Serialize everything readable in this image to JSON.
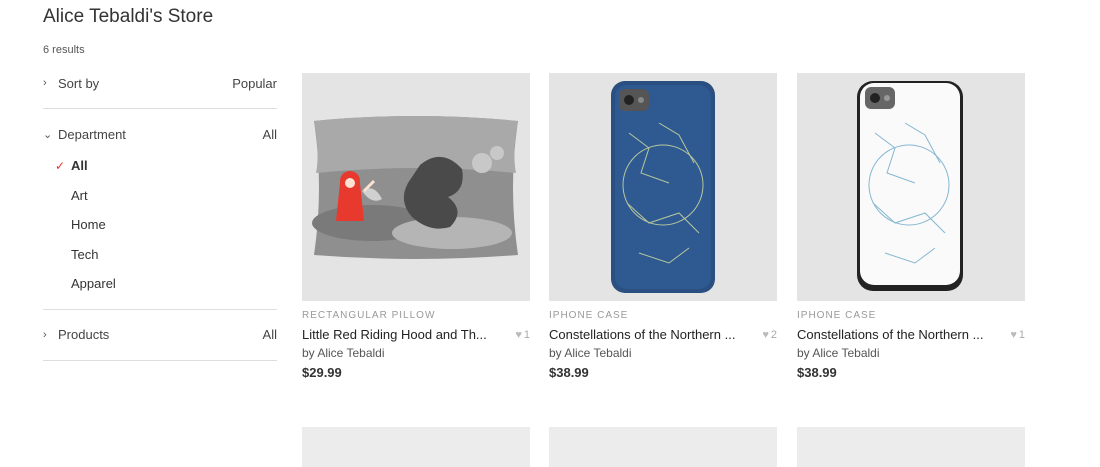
{
  "store": {
    "title": "Alice Tebaldi's Store",
    "results": "6 results"
  },
  "sidebar": {
    "sort": {
      "label": "Sort by",
      "value": "Popular"
    },
    "department": {
      "label": "Department",
      "value": "All",
      "items": [
        {
          "label": "All",
          "active": true
        },
        {
          "label": "Art"
        },
        {
          "label": "Home"
        },
        {
          "label": "Tech"
        },
        {
          "label": "Apparel"
        }
      ]
    },
    "products": {
      "label": "Products",
      "value": "All"
    }
  },
  "products": [
    {
      "type": "RECTANGULAR PILLOW",
      "name": "Little Red Riding Hood and Th...",
      "likes": "1",
      "byline": "by Alice Tebaldi",
      "price": "$29.99"
    },
    {
      "type": "IPHONE CASE",
      "name": "Constellations of the Northern ...",
      "likes": "2",
      "byline": "by Alice Tebaldi",
      "price": "$38.99"
    },
    {
      "type": "IPHONE CASE",
      "name": "Constellations of the Northern ...",
      "likes": "1",
      "byline": "by Alice Tebaldi",
      "price": "$38.99"
    }
  ],
  "colors": {
    "accent_check": "#e0342a",
    "case_blue": "#2a4f80"
  },
  "icons": {
    "chevron_right": "chevron-right-icon",
    "chevron_down": "chevron-down-icon",
    "check": "check-icon",
    "heart": "heart-icon"
  }
}
